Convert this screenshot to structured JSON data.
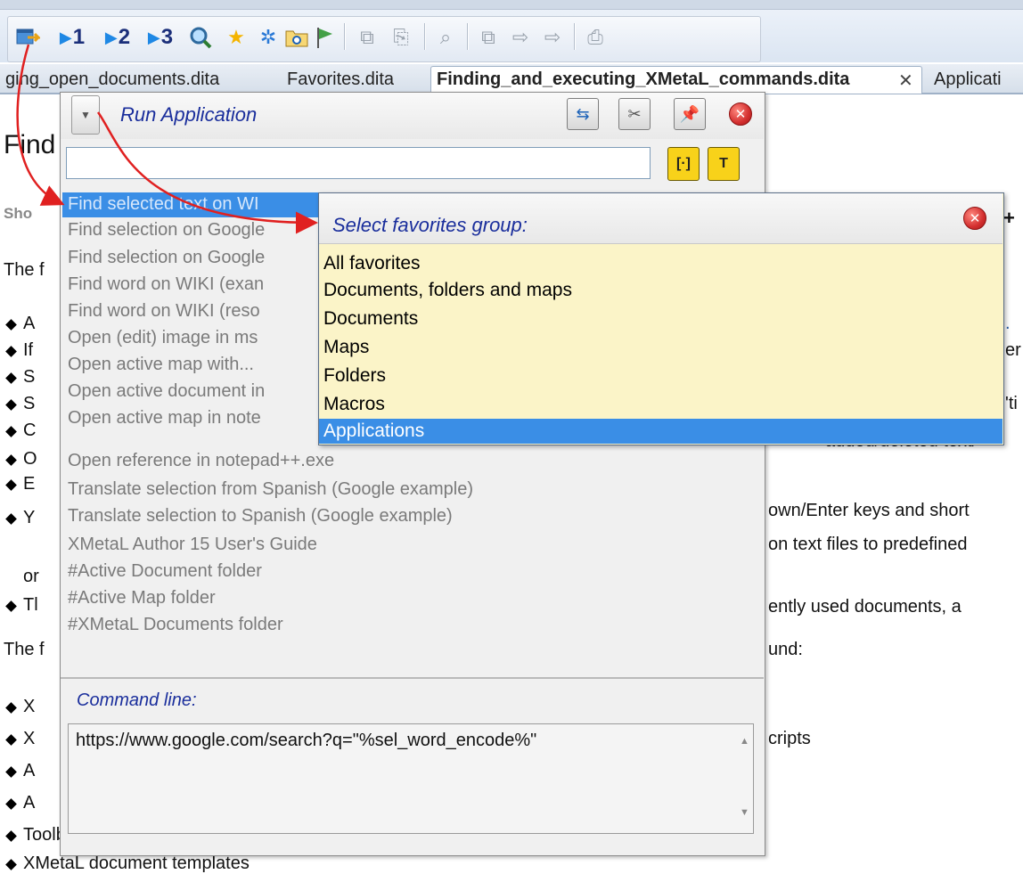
{
  "toolbar": {
    "run_app_icon": "run-application-icon",
    "bookmark_1": "1",
    "bookmark_2": "2",
    "bookmark_3": "3"
  },
  "tabs": [
    {
      "label": "ging_open_documents.dita"
    },
    {
      "label": "Favorites.dita"
    },
    {
      "label": "Finding_and_executing_XMetaL_commands.dita"
    },
    {
      "label": "Applicati"
    }
  ],
  "document": {
    "heading": "Find",
    "short_line": "Sho",
    "intro": "The f",
    "bullets": [
      {
        "left": "A",
        "right": "."
      },
      {
        "left": "If",
        "right": "er"
      },
      {
        "left": "S",
        "right": ""
      },
      {
        "left": "S",
        "right": "'ti"
      },
      {
        "left": "C",
        "right": "added/deleted text/"
      },
      {
        "left": "O",
        "right": ""
      },
      {
        "left": "E",
        "right": "own/Enter keys and short"
      },
      {
        "left": "Y",
        "right": "on text files to predefined"
      },
      {
        "left": "or",
        "right": ""
      },
      {
        "left": "Tl",
        "right": "ently used documents, a"
      }
    ],
    "intro2_left": "The f",
    "intro2_right": "und:",
    "bullets2": [
      {
        "left": "X",
        "right": ""
      },
      {
        "left": "X",
        "right": "cripts"
      },
      {
        "left": "A",
        "right": ""
      },
      {
        "left": "A",
        "right": ""
      },
      {
        "left": "Toolbars commands",
        "right": ""
      },
      {
        "left": "XMetaL document templates",
        "right": ""
      }
    ],
    "plus_sign": "+"
  },
  "run_application": {
    "title": "Run Application",
    "search_value": "",
    "commands": [
      "Find selected text on WI",
      "Find selection on Google",
      "Find selection on Google",
      "Find word on WIKI (exan",
      "Find word on WIKI (reso",
      "Open (edit) image in ms",
      "Open active map with...",
      "Open active document in",
      "Open active map in note",
      "Open reference in notepad++.exe",
      "Translate selection from Spanish (Google example)",
      "Translate selection to Spanish (Google example)",
      "XMetaL Author 15 User's Guide",
      "#Active Document folder",
      "#Active Map folder",
      "#XMetaL Documents folder"
    ],
    "selected_index": 0,
    "command_line_label": "Command line:",
    "command_line_value": "https://www.google.com/search?q=\"%sel_word_encode%\""
  },
  "favorites_popup": {
    "title": "Select favorites group:",
    "groups": [
      "All favorites",
      "Documents, folders and maps",
      "Documents",
      "Maps",
      "Folders",
      "Macros",
      "Applications"
    ],
    "selected": "Applications"
  },
  "colors": {
    "selection": "#3a8ee6",
    "title_blue": "#1a2e9c",
    "favorites_bg": "#fbf4c8",
    "arrow_red": "#e02020"
  }
}
